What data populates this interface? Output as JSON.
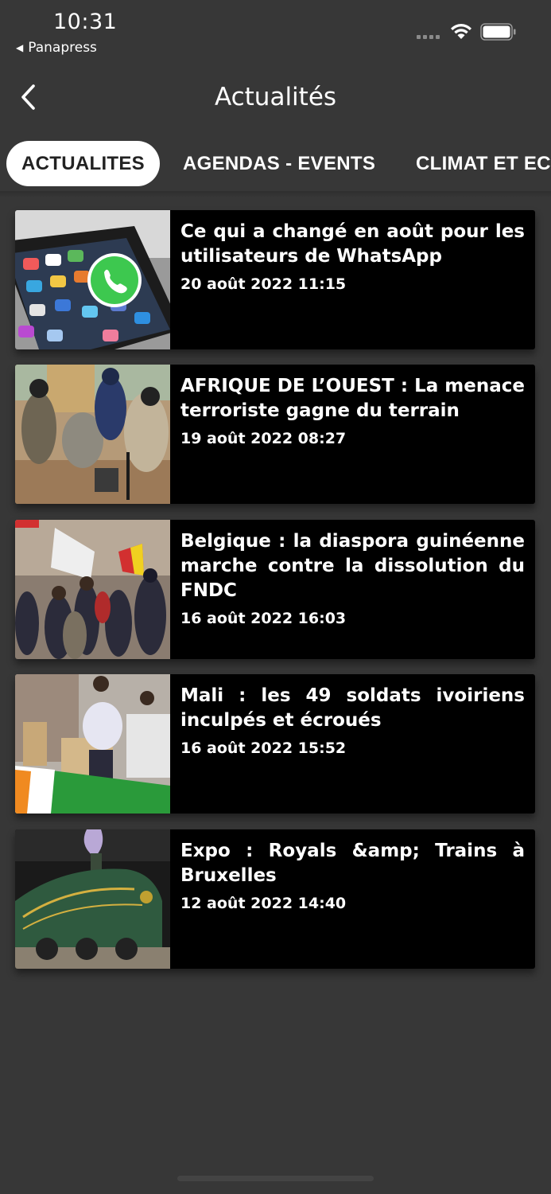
{
  "status_bar": {
    "time": "10:31",
    "back_app": "Panapress",
    "back_icon": "triangle-left-icon"
  },
  "nav": {
    "title": "Actualités",
    "back_icon": "chevron-left-icon"
  },
  "tabs": [
    {
      "label": "ACTUALITES",
      "active": true
    },
    {
      "label": "AGENDAS - EVENTS",
      "active": false
    },
    {
      "label": "CLIMAT ET ECO",
      "active": false
    }
  ],
  "articles": [
    {
      "title": "Ce qui a changé en août pour les utilisateurs de WhatsApp",
      "date": "20 août 2022 11:15",
      "image": "phone-whatsapp-image"
    },
    {
      "title": "AFRIQUE DE L’OUEST : La menace terroriste gagne du terrain",
      "date": "19 août 2022 08:27",
      "image": "armed-men-image"
    },
    {
      "title": "Belgique : la diaspora guinéenne marche contre la dissolution du FNDC",
      "date": "16 août 2022 16:03",
      "image": "protest-march-image"
    },
    {
      "title": "Mali : les 49 soldats ivoiriens inculpés et écroués",
      "date": "16 août 2022 15:52",
      "image": "protest-signs-image"
    },
    {
      "title": "Expo : Royals &amp; Trains à Bruxelles",
      "date": "12 août 2022 14:40",
      "image": "steam-train-image"
    }
  ],
  "colors": {
    "background": "#373737",
    "card": "#000000",
    "active_tab": "#ffffff",
    "text": "#ffffff"
  }
}
